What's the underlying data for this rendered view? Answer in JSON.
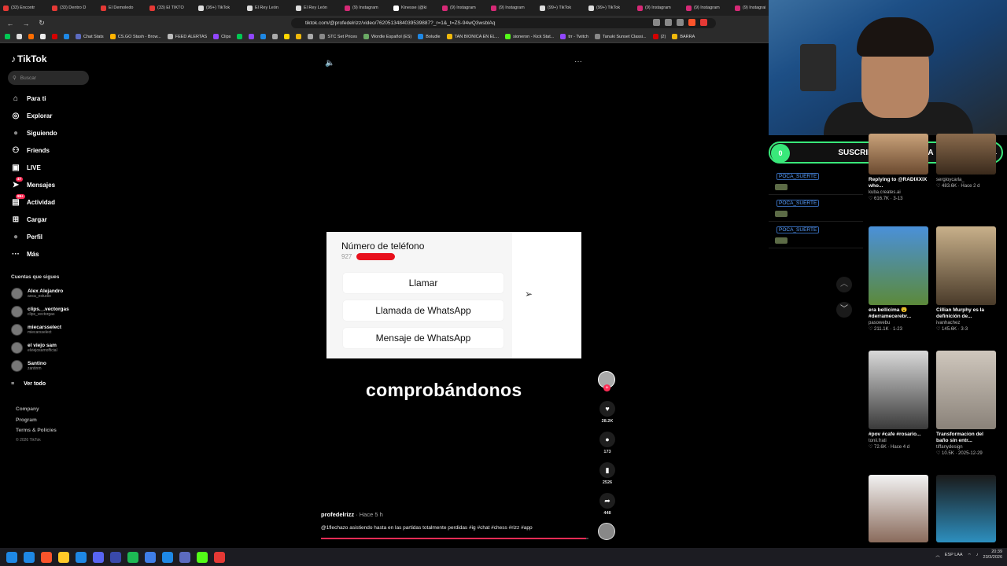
{
  "browser": {
    "tabs": [
      {
        "label": "(33) Encontr",
        "color": "#e53935"
      },
      {
        "label": "(33) Dentro D",
        "color": "#e53935"
      },
      {
        "label": "El Demoledo",
        "color": "#e53935"
      },
      {
        "label": "(33) El TIKTO",
        "color": "#e53935"
      },
      {
        "label": "(99+) TikTok",
        "color": "#dddddd"
      },
      {
        "label": "El Rey León",
        "color": "#dddddd"
      },
      {
        "label": "El Rey León",
        "color": "#dddddd"
      },
      {
        "label": "(9) Instagram",
        "color": "#d62976"
      },
      {
        "label": "Kinesse (@ki",
        "color": "#ffffff"
      },
      {
        "label": "(9) Instagram",
        "color": "#d62976"
      },
      {
        "label": "(9) Instagram",
        "color": "#d62976"
      },
      {
        "label": "(99+) TikTok",
        "color": "#dddddd"
      },
      {
        "label": "(99+) TikTok",
        "color": "#dddddd"
      },
      {
        "label": "(9) Instagram",
        "color": "#d62976"
      },
      {
        "label": "(9) Instagram",
        "color": "#d62976"
      },
      {
        "label": "(9) Instagrai",
        "color": "#d62976"
      }
    ],
    "url": "tiktok.com/@profedelrizz/video/7620513484039539887?_r=1&_t=ZS-94wQ3wsblAq",
    "bookmarks": [
      {
        "label": "",
        "color": "#00c853"
      },
      {
        "label": "",
        "color": "#dddddd"
      },
      {
        "label": "",
        "color": "#ff6d00"
      },
      {
        "label": "",
        "color": "#eeeeee"
      },
      {
        "label": "",
        "color": "#d50000"
      },
      {
        "label": "",
        "color": "#1e88e5"
      },
      {
        "label": "Chat Stats",
        "color": "#5c6bc0"
      },
      {
        "label": "CS.GO Stash - Brow...",
        "color": "#ffb300"
      },
      {
        "label": "FEED ALERTAS",
        "color": "#bbbbbb"
      },
      {
        "label": "Clips",
        "color": "#9146ff"
      },
      {
        "label": "",
        "color": "#00c853"
      },
      {
        "label": "",
        "color": "#9146ff"
      },
      {
        "label": "",
        "color": "#1e88e5"
      },
      {
        "label": "",
        "color": "#aaaaaa"
      },
      {
        "label": "",
        "color": "#ffd600"
      },
      {
        "label": "",
        "color": "#f0b90b"
      },
      {
        "label": "",
        "color": "#aaaaaa"
      },
      {
        "label": "STC Set Prices",
        "color": "#888888"
      },
      {
        "label": "Wordle Español (ES)",
        "color": "#6aaa64"
      },
      {
        "label": "Boludle",
        "color": "#1e88e5"
      },
      {
        "label": "TAN BIONICA EN EL...",
        "color": "#f0b90b"
      },
      {
        "label": "sioneron - Kick Stat...",
        "color": "#53fc18"
      },
      {
        "label": "trr - Twitch",
        "color": "#9146ff"
      },
      {
        "label": "Tanuki Sunset Classi...",
        "color": "#888888"
      },
      {
        "label": "(2)",
        "color": "#d50000"
      },
      {
        "label": "BARRA",
        "color": "#f0b90b"
      }
    ]
  },
  "tiktok": {
    "logo": "TikTok",
    "search_placeholder": "Buscar",
    "nav": [
      {
        "label": "Para ti",
        "icon": "home-icon",
        "glyph": "⌂"
      },
      {
        "label": "Explorar",
        "icon": "compass-icon",
        "glyph": "◎"
      },
      {
        "label": "Siguiendo",
        "icon": "following-avatar-icon",
        "glyph": "●"
      },
      {
        "label": "Friends",
        "icon": "friends-icon",
        "glyph": "⚇"
      },
      {
        "label": "LIVE",
        "icon": "live-icon",
        "glyph": "▣"
      },
      {
        "label": "Mensajes",
        "icon": "messages-icon",
        "glyph": "➤",
        "badge": "47"
      },
      {
        "label": "Actividad",
        "icon": "activity-icon",
        "glyph": "▤",
        "badge": "99+"
      },
      {
        "label": "Cargar",
        "icon": "upload-icon",
        "glyph": "⊞"
      },
      {
        "label": "Perfil",
        "icon": "profile-avatar-icon",
        "glyph": "●"
      },
      {
        "label": "Más",
        "icon": "more-icon",
        "glyph": "···"
      }
    ],
    "following_header": "Cuentas que sigues",
    "following": [
      {
        "name": "Alex Alejandro",
        "handle": "aoca_estudio"
      },
      {
        "name": "clips._.vectorgas",
        "handle": "clips_vectorgas"
      },
      {
        "name": "miecarsselect",
        "handle": "miecarsselect"
      },
      {
        "name": "el viejo sam",
        "handle": "elviejosamofficial"
      },
      {
        "name": "Santino",
        "handle": "zantinm"
      }
    ],
    "see_all": "Ver todo",
    "footer": [
      "Company",
      "Program",
      "Terms & Policies"
    ],
    "copyright": "© 2026 TikTok"
  },
  "video": {
    "card_title": "Número de teléfono",
    "card_number": "927",
    "buttons": [
      "Llamar",
      "Llamada de WhatsApp",
      "Mensaje de WhatsApp"
    ],
    "caption": "comprobándonos",
    "likes": "28.2K",
    "comments": "173",
    "saves": "2526",
    "shares": "448",
    "author": "profedelrizz",
    "time": " · Hace 5 h",
    "description": "@1flechazo asistiendo hasta en las partidas totalmente perdidas #ig #chat #chess #rizz #app",
    "progress": 0.99
  },
  "stream": {
    "sub_title": "SUSCRIPTORES DEL DIA",
    "sub_count": "0",
    "sub_end": "1",
    "chat_tag": "POCA_SUERTE",
    "accent": "#39e87a"
  },
  "feed": [
    {
      "title": "Replying to @RADIXXIX who...",
      "user": "kuba.creates.ai",
      "meta": "♡ 616.7K · 3-13",
      "colA": "#c9a27a",
      "colB": "#6b4a30",
      "col": 0,
      "row": 0
    },
    {
      "title": "",
      "user": "sergioycarla_",
      "meta": "♡ 483.6K · Hace 2 d",
      "colA": "#8a6b4d",
      "colB": "#3a2a1c",
      "col": 1,
      "row": 0
    },
    {
      "title": "era bellicima 😮 #derramecerebr...",
      "user": "pasowebu",
      "meta": "♡ 211.1K · 1-23",
      "colA": "#4a90d9",
      "colB": "#5c8a3a",
      "col": 0,
      "row": 1
    },
    {
      "title": "Cillian Murphy es la definición de...",
      "user": "ivanhachez",
      "meta": "♡ 145.6K · 3-3",
      "colA": "#c8b08a",
      "colB": "#4a3b2a",
      "col": 1,
      "row": 1
    },
    {
      "title": "#pov #cafe #rosario...",
      "user": "tonii.frati",
      "meta": "♡ 72.6K · Hace 4 d",
      "colA": "#d9d9d9",
      "colB": "#3a3a3a",
      "col": 0,
      "row": 2
    },
    {
      "title": "Transformacion del baño sin entr...",
      "user": "tiffanydesign",
      "meta": "♡ 10.5K · 2025-12-29",
      "colA": "#cfc7bd",
      "colB": "#8a8279",
      "col": 1,
      "row": 2
    },
    {
      "title": "",
      "user": "",
      "meta": "",
      "colA": "#f2f2f2",
      "colB": "#8a6b5c",
      "col": 0,
      "row": 3
    },
    {
      "title": "",
      "user": "",
      "meta": "",
      "colA": "#1a1a1a",
      "colB": "#2d8fbf",
      "col": 1,
      "row": 3
    }
  ],
  "taskbar": {
    "apps": [
      "#1e88e5",
      "#fb542b",
      "#ffca28",
      "#1e88e5",
      "#5865f2",
      "#3949ab",
      "#1db954",
      "#3f7ee8",
      "#1e88e5",
      "#5c6bc0",
      "#53fc18",
      "#e53935"
    ],
    "lang": "ESP LAA",
    "time": "20:39",
    "date": "23/3/2026"
  }
}
